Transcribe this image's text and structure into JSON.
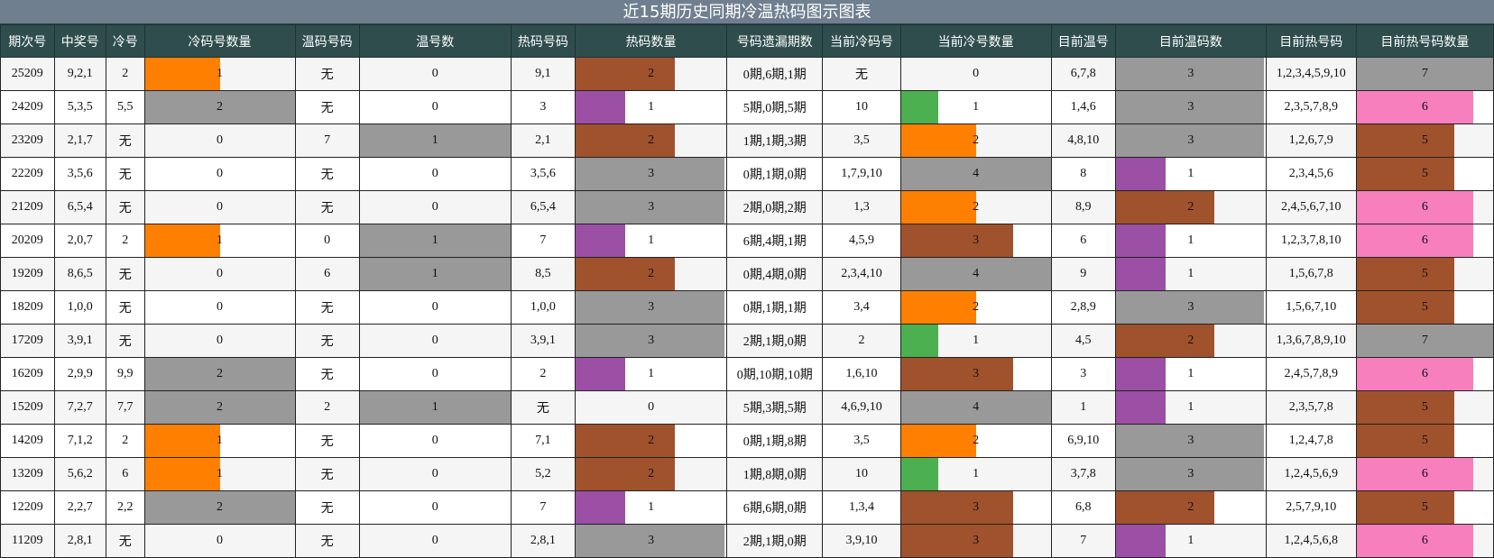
{
  "title": "近15期历史同期冷温热码图示图表",
  "headers": [
    "期次号",
    "中奖号",
    "冷号",
    "冷码号数量",
    "温码号码",
    "温号数",
    "热码号码",
    "热码数量",
    "号码遗漏期数",
    "当前冷码号",
    "当前冷号数量",
    "目前温号",
    "目前温码数",
    "目前热号码",
    "目前热号码数量"
  ],
  "colors": {
    "count_1": "#ff8000",
    "count_2": "#999999",
    "count_3": "#a0522d",
    "count_4": "#999999",
    "count_1_alt": "#9b4fa5",
    "count_1_green": "#4caf50",
    "count_5": "#a0522d",
    "count_6": "#f77fbe",
    "count_7": "#999999"
  },
  "rows": [
    {
      "issue": "25209",
      "win": "9,2,1",
      "cold": "2",
      "cold_cnt": "1",
      "warm": "无",
      "warm_cnt": "0",
      "hot": "9,1",
      "hot_cnt": "2",
      "miss": "0期,6期,1期",
      "cur_cold": "无",
      "cur_cold_cnt": "0",
      "cur_warm": "6,7,8",
      "cur_warm_cnt": "3",
      "cur_hot": "1,2,3,4,5,9,10",
      "cur_hot_cnt": "7"
    },
    {
      "issue": "24209",
      "win": "5,3,5",
      "cold": "5,5",
      "cold_cnt": "2",
      "warm": "无",
      "warm_cnt": "0",
      "hot": "3",
      "hot_cnt": "1",
      "miss": "5期,0期,5期",
      "cur_cold": "10",
      "cur_cold_cnt": "1",
      "cur_warm": "1,4,6",
      "cur_warm_cnt": "3",
      "cur_hot": "2,3,5,7,8,9",
      "cur_hot_cnt": "6"
    },
    {
      "issue": "23209",
      "win": "2,1,7",
      "cold": "无",
      "cold_cnt": "0",
      "warm": "7",
      "warm_cnt": "1",
      "hot": "2,1",
      "hot_cnt": "2",
      "miss": "1期,1期,3期",
      "cur_cold": "3,5",
      "cur_cold_cnt": "2",
      "cur_warm": "4,8,10",
      "cur_warm_cnt": "3",
      "cur_hot": "1,2,6,7,9",
      "cur_hot_cnt": "5"
    },
    {
      "issue": "22209",
      "win": "3,5,6",
      "cold": "无",
      "cold_cnt": "0",
      "warm": "无",
      "warm_cnt": "0",
      "hot": "3,5,6",
      "hot_cnt": "3",
      "miss": "0期,1期,0期",
      "cur_cold": "1,7,9,10",
      "cur_cold_cnt": "4",
      "cur_warm": "8",
      "cur_warm_cnt": "1",
      "cur_hot": "2,3,4,5,6",
      "cur_hot_cnt": "5"
    },
    {
      "issue": "21209",
      "win": "6,5,4",
      "cold": "无",
      "cold_cnt": "0",
      "warm": "无",
      "warm_cnt": "0",
      "hot": "6,5,4",
      "hot_cnt": "3",
      "miss": "2期,0期,2期",
      "cur_cold": "1,3",
      "cur_cold_cnt": "2",
      "cur_warm": "8,9",
      "cur_warm_cnt": "2",
      "cur_hot": "2,4,5,6,7,10",
      "cur_hot_cnt": "6"
    },
    {
      "issue": "20209",
      "win": "2,0,7",
      "cold": "2",
      "cold_cnt": "1",
      "warm": "0",
      "warm_cnt": "1",
      "hot": "7",
      "hot_cnt": "1",
      "miss": "6期,4期,1期",
      "cur_cold": "4,5,9",
      "cur_cold_cnt": "3",
      "cur_warm": "6",
      "cur_warm_cnt": "1",
      "cur_hot": "1,2,3,7,8,10",
      "cur_hot_cnt": "6"
    },
    {
      "issue": "19209",
      "win": "8,6,5",
      "cold": "无",
      "cold_cnt": "0",
      "warm": "6",
      "warm_cnt": "1",
      "hot": "8,5",
      "hot_cnt": "2",
      "miss": "0期,4期,0期",
      "cur_cold": "2,3,4,10",
      "cur_cold_cnt": "4",
      "cur_warm": "9",
      "cur_warm_cnt": "1",
      "cur_hot": "1,5,6,7,8",
      "cur_hot_cnt": "5"
    },
    {
      "issue": "18209",
      "win": "1,0,0",
      "cold": "无",
      "cold_cnt": "0",
      "warm": "无",
      "warm_cnt": "0",
      "hot": "1,0,0",
      "hot_cnt": "3",
      "miss": "0期,1期,1期",
      "cur_cold": "3,4",
      "cur_cold_cnt": "2",
      "cur_warm": "2,8,9",
      "cur_warm_cnt": "3",
      "cur_hot": "1,5,6,7,10",
      "cur_hot_cnt": "5"
    },
    {
      "issue": "17209",
      "win": "3,9,1",
      "cold": "无",
      "cold_cnt": "0",
      "warm": "无",
      "warm_cnt": "0",
      "hot": "3,9,1",
      "hot_cnt": "3",
      "miss": "2期,1期,0期",
      "cur_cold": "2",
      "cur_cold_cnt": "1",
      "cur_warm": "4,5",
      "cur_warm_cnt": "2",
      "cur_hot": "1,3,6,7,8,9,10",
      "cur_hot_cnt": "7"
    },
    {
      "issue": "16209",
      "win": "2,9,9",
      "cold": "9,9",
      "cold_cnt": "2",
      "warm": "无",
      "warm_cnt": "0",
      "hot": "2",
      "hot_cnt": "1",
      "miss": "0期,10期,10期",
      "cur_cold": "1,6,10",
      "cur_cold_cnt": "3",
      "cur_warm": "3",
      "cur_warm_cnt": "1",
      "cur_hot": "2,4,5,7,8,9",
      "cur_hot_cnt": "6"
    },
    {
      "issue": "15209",
      "win": "7,2,7",
      "cold": "7,7",
      "cold_cnt": "2",
      "warm": "2",
      "warm_cnt": "1",
      "hot": "无",
      "hot_cnt": "0",
      "miss": "5期,3期,5期",
      "cur_cold": "4,6,9,10",
      "cur_cold_cnt": "4",
      "cur_warm": "1",
      "cur_warm_cnt": "1",
      "cur_hot": "2,3,5,7,8",
      "cur_hot_cnt": "5"
    },
    {
      "issue": "14209",
      "win": "7,1,2",
      "cold": "2",
      "cold_cnt": "1",
      "warm": "无",
      "warm_cnt": "0",
      "hot": "7,1",
      "hot_cnt": "2",
      "miss": "0期,1期,8期",
      "cur_cold": "3,5",
      "cur_cold_cnt": "2",
      "cur_warm": "6,9,10",
      "cur_warm_cnt": "3",
      "cur_hot": "1,2,4,7,8",
      "cur_hot_cnt": "5"
    },
    {
      "issue": "13209",
      "win": "5,6,2",
      "cold": "6",
      "cold_cnt": "1",
      "warm": "无",
      "warm_cnt": "0",
      "hot": "5,2",
      "hot_cnt": "2",
      "miss": "1期,8期,0期",
      "cur_cold": "10",
      "cur_cold_cnt": "1",
      "cur_warm": "3,7,8",
      "cur_warm_cnt": "3",
      "cur_hot": "1,2,4,5,6,9",
      "cur_hot_cnt": "6"
    },
    {
      "issue": "12209",
      "win": "2,2,7",
      "cold": "2,2",
      "cold_cnt": "2",
      "warm": "无",
      "warm_cnt": "0",
      "hot": "7",
      "hot_cnt": "1",
      "miss": "6期,6期,0期",
      "cur_cold": "1,3,4",
      "cur_cold_cnt": "3",
      "cur_warm": "6,8",
      "cur_warm_cnt": "2",
      "cur_hot": "2,5,7,9,10",
      "cur_hot_cnt": "5"
    },
    {
      "issue": "11209",
      "win": "2,8,1",
      "cold": "无",
      "cold_cnt": "0",
      "warm": "无",
      "warm_cnt": "0",
      "hot": "2,8,1",
      "hot_cnt": "3",
      "miss": "2期,1期,0期",
      "cur_cold": "3,9,10",
      "cur_cold_cnt": "3",
      "cur_warm": "7",
      "cur_warm_cnt": "1",
      "cur_hot": "1,2,4,5,6,8",
      "cur_hot_cnt": "6"
    }
  ]
}
